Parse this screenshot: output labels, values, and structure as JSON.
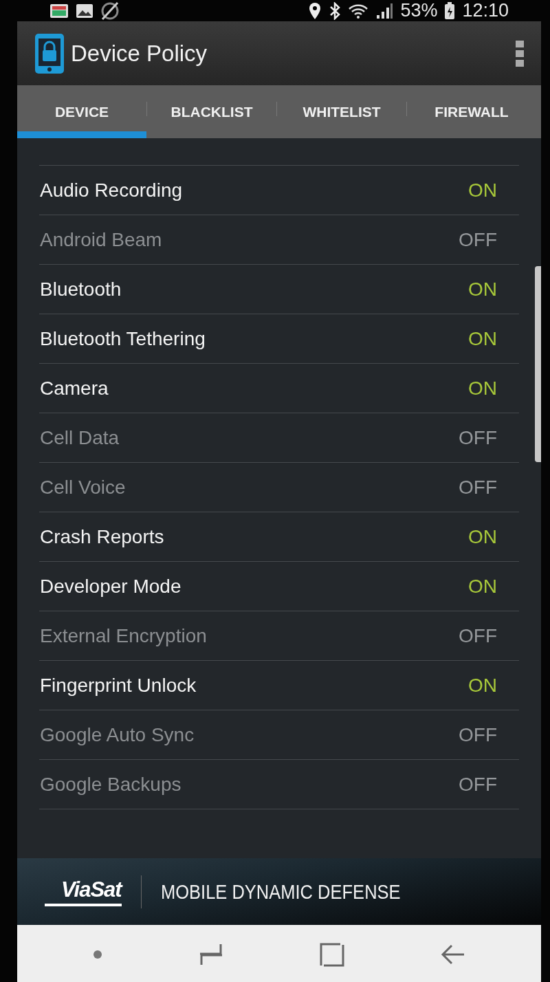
{
  "status_bar": {
    "battery": "53%",
    "time": "12:10"
  },
  "app_bar": {
    "title": "Device Policy"
  },
  "tabs": [
    {
      "label": "DEVICE",
      "selected": true
    },
    {
      "label": "BLACKLIST",
      "selected": false
    },
    {
      "label": "WHITELIST",
      "selected": false
    },
    {
      "label": "FIREWALL",
      "selected": false
    }
  ],
  "settings": [
    {
      "label": "Audio Recording",
      "value": "ON",
      "on": true
    },
    {
      "label": "Android Beam",
      "value": "OFF",
      "on": false
    },
    {
      "label": "Bluetooth",
      "value": "ON",
      "on": true
    },
    {
      "label": "Bluetooth Tethering",
      "value": "ON",
      "on": true
    },
    {
      "label": "Camera",
      "value": "ON",
      "on": true
    },
    {
      "label": "Cell Data",
      "value": "OFF",
      "on": false
    },
    {
      "label": "Cell Voice",
      "value": "OFF",
      "on": false
    },
    {
      "label": "Crash Reports",
      "value": "ON",
      "on": true
    },
    {
      "label": "Developer Mode",
      "value": "ON",
      "on": true
    },
    {
      "label": "External Encryption",
      "value": "OFF",
      "on": false
    },
    {
      "label": "Fingerprint Unlock",
      "value": "ON",
      "on": true
    },
    {
      "label": "Google Auto Sync",
      "value": "OFF",
      "on": false
    },
    {
      "label": "Google Backups",
      "value": "OFF",
      "on": false
    }
  ],
  "footer": {
    "brand": "ViaSat",
    "tagline": "MOBILE DYNAMIC DEFENSE"
  }
}
